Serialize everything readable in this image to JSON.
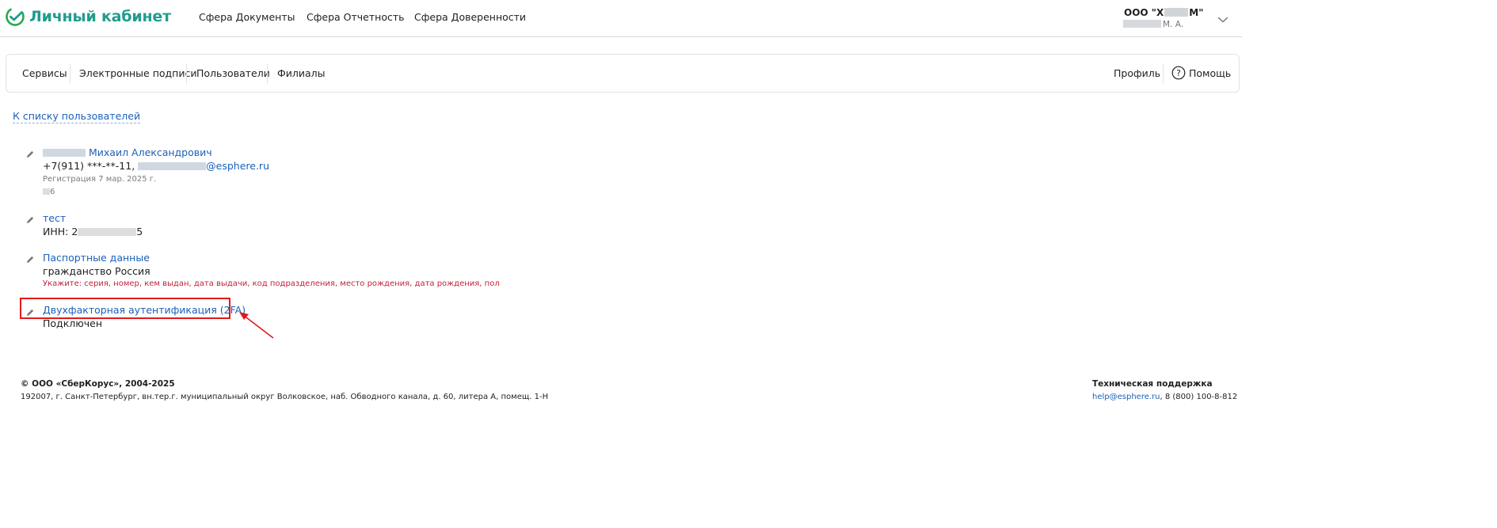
{
  "header": {
    "logo_text": "Личный кабинет",
    "nav": [
      "Сфера Документы",
      "Сфера Отчетность",
      "Сфера Доверенности"
    ],
    "company_prefix": "ООО \"Х",
    "company_suffix": "М\"",
    "user_suffix": "М. А."
  },
  "subnav": {
    "items": [
      "Сервисы",
      "Электронные подписи",
      "Пользователи",
      "Филиалы"
    ],
    "profile": "Профиль",
    "help": "Помощь"
  },
  "back_link": "К списку пользователей",
  "user_block": {
    "name": "Михаил Александрович",
    "phone": "+7(911) ***-**-11,",
    "email_suffix": "@esphere.ru",
    "registration": "Регистрация 7 мар. 2025 г.",
    "id_suffix": "6"
  },
  "org_block": {
    "title": "тест",
    "inn_label": "ИНН: 2",
    "inn_suffix": "5"
  },
  "passport_block": {
    "title": "Паспортные данные",
    "citizenship": "гражданство Россия",
    "warning": "Укажите: серия, номер, кем выдан, дата выдачи, код подразделения, место рождения, дата рождения, пол"
  },
  "twofa_block": {
    "title": "Двухфакторная аутентификация (2FA)",
    "status": "Подключен"
  },
  "footer": {
    "copyright": "© ООО «СберКорус», 2004-2025",
    "address": "192007, г. Санкт-Петербург, вн.тер.г. муниципальный округ Волковское, наб. Обводного канала, д. 60, литера А, помещ. 1-Н",
    "support_title": "Техническая поддержка",
    "support_email": "help@esphere.ru",
    "support_phone": ", 8 (800) 100-8-812"
  },
  "colors": {
    "brand": "#1f9d8c",
    "link": "#1c61b8",
    "warning": "#c4213a",
    "highlight": "#e01a1a"
  }
}
